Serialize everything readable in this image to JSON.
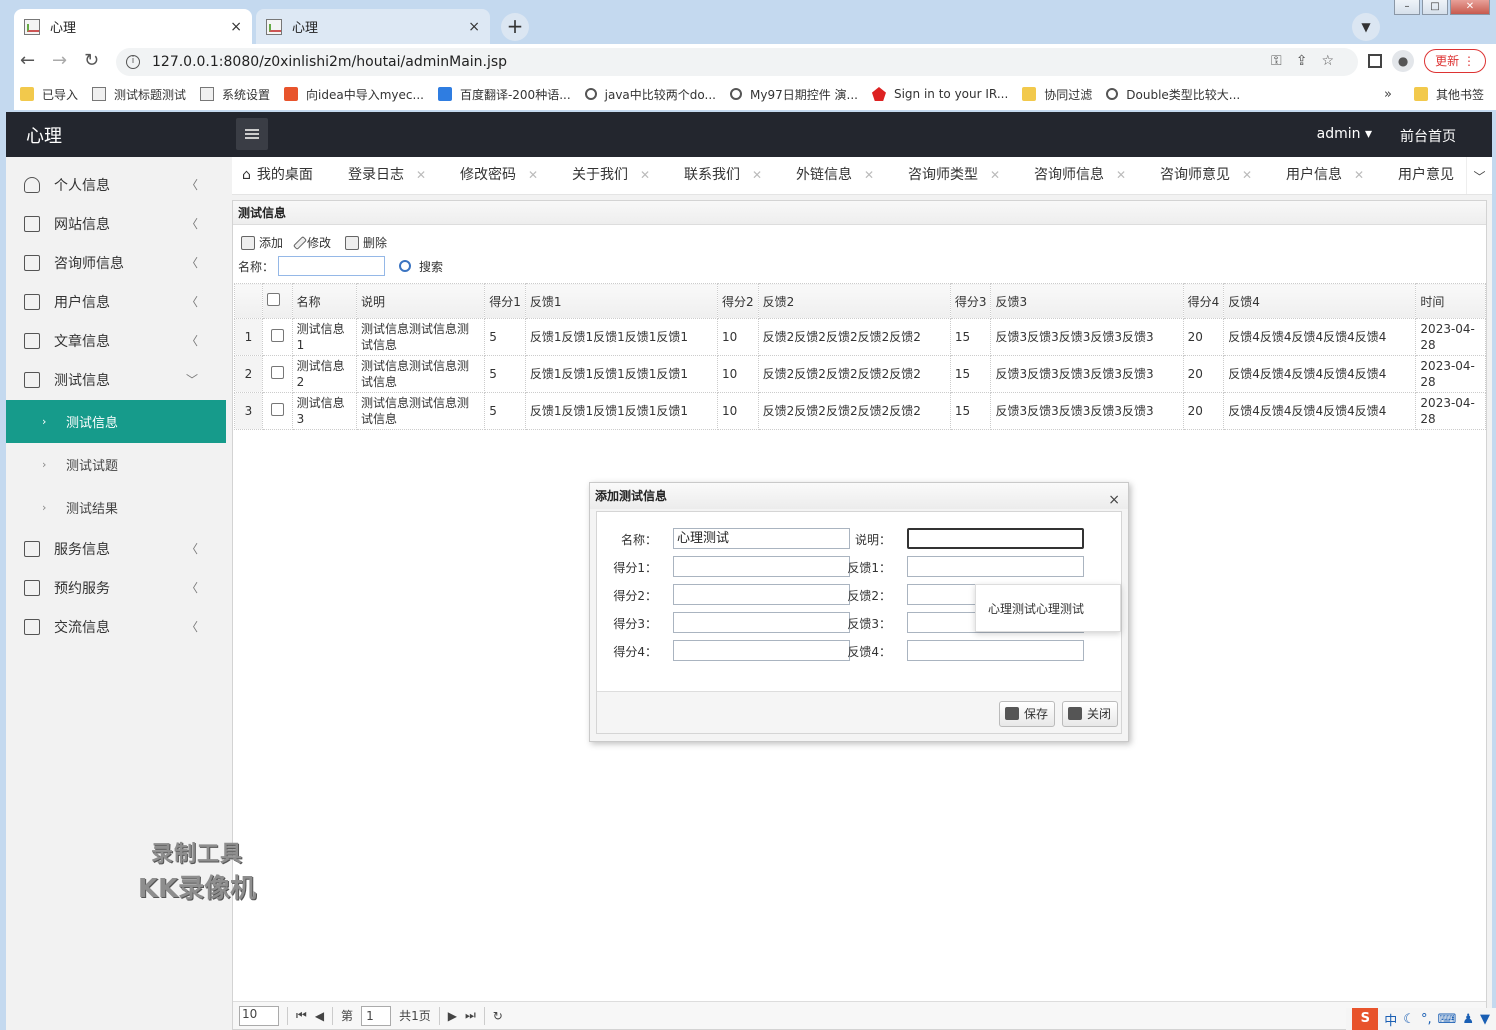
{
  "browser": {
    "tabs": [
      {
        "title": "心理"
      },
      {
        "title": "心理"
      }
    ],
    "tab_close": "×",
    "new_tab": "+",
    "url": "127.0.0.1:8080/z0xinlishi2m/houtai/adminMain.jsp",
    "update_label": "更新",
    "bookmarks": [
      {
        "label": "已导入",
        "icon": "folder"
      },
      {
        "label": "测试标题测试",
        "icon": "pic"
      },
      {
        "label": "系统设置",
        "icon": "pic"
      },
      {
        "label": "向idea中导入myec...",
        "icon": "red"
      },
      {
        "label": "百度翻译-200种语...",
        "icon": "blue"
      },
      {
        "label": "java中比较两个do...",
        "icon": "swirl"
      },
      {
        "label": "My97日期控件 演...",
        "icon": "swirl"
      },
      {
        "label": "Sign in to your IR...",
        "icon": "leaf"
      },
      {
        "label": "协同过滤",
        "icon": "folder"
      },
      {
        "label": "Double类型比较大...",
        "icon": "swirl"
      }
    ],
    "bookmarks_more": "»",
    "other_bookmarks": "其他书签"
  },
  "header": {
    "logo": "心理",
    "user": "admin ▾",
    "home_link": "前台首页"
  },
  "sidebar": {
    "items": [
      {
        "label": "个人信息"
      },
      {
        "label": "网站信息"
      },
      {
        "label": "咨询师信息"
      },
      {
        "label": "用户信息"
      },
      {
        "label": "文章信息"
      },
      {
        "label": "测试信息"
      },
      {
        "label": "服务信息"
      },
      {
        "label": "预约服务"
      },
      {
        "label": "交流信息"
      }
    ],
    "subitems": [
      {
        "label": "测试信息"
      },
      {
        "label": "测试试题"
      },
      {
        "label": "测试结果"
      }
    ]
  },
  "page_tabs": [
    {
      "label": "我的桌面"
    },
    {
      "label": "登录日志"
    },
    {
      "label": "修改密码"
    },
    {
      "label": "关于我们"
    },
    {
      "label": "联系我们"
    },
    {
      "label": "外链信息"
    },
    {
      "label": "咨询师类型"
    },
    {
      "label": "咨询师信息"
    },
    {
      "label": "咨询师意见"
    },
    {
      "label": "用户信息"
    },
    {
      "label": "用户意见"
    }
  ],
  "panel": {
    "title": "测试信息",
    "tools": {
      "add": "添加",
      "edit": "修改",
      "delete": "删除"
    },
    "search_label": "名称：",
    "search_value": "",
    "search_button": "搜索"
  },
  "grid": {
    "headers": [
      "名称",
      "说明",
      "得分1",
      "反馈1",
      "得分2",
      "反馈2",
      "得分3",
      "反馈3",
      "得分4",
      "反馈4",
      "时间"
    ],
    "rows": [
      {
        "n": "1",
        "cells": [
          "测试信息1",
          "测试信息测试信息测试信息",
          "5",
          "反馈1反馈1反馈1反馈1反馈1",
          "10",
          "反馈2反馈2反馈2反馈2反馈2",
          "15",
          "反馈3反馈3反馈3反馈3反馈3",
          "20",
          "反馈4反馈4反馈4反馈4反馈4",
          "2023-04-28"
        ]
      },
      {
        "n": "2",
        "cells": [
          "测试信息2",
          "测试信息测试信息测试信息",
          "5",
          "反馈1反馈1反馈1反馈1反馈1",
          "10",
          "反馈2反馈2反馈2反馈2反馈2",
          "15",
          "反馈3反馈3反馈3反馈3反馈3",
          "20",
          "反馈4反馈4反馈4反馈4反馈4",
          "2023-04-28"
        ]
      },
      {
        "n": "3",
        "cells": [
          "测试信息3",
          "测试信息测试信息测试信息",
          "5",
          "反馈1反馈1反馈1反馈1反馈1",
          "10",
          "反馈2反馈2反馈2反馈2反馈2",
          "15",
          "反馈3反馈3反馈3反馈3反馈3",
          "20",
          "反馈4反馈4反馈4反馈4反馈4",
          "2023-04-28"
        ]
      }
    ]
  },
  "pager": {
    "page_size": "10",
    "page_prefix": "第",
    "page_number": "1",
    "page_total": "共1页"
  },
  "dialog": {
    "title": "添加测试信息",
    "close": "×",
    "labels": {
      "name": "名称：",
      "desc": "说明：",
      "score1": "得分1：",
      "fb1": "反馈1：",
      "score2": "得分2：",
      "fb2": "反馈2：",
      "score3": "得分3：",
      "fb3": "反馈3：",
      "score4": "得分4：",
      "fb4": "反馈4："
    },
    "values": {
      "name": "心理测试",
      "desc": "",
      "score1": "",
      "fb1": "",
      "score2": "",
      "fb2": "",
      "score3": "",
      "fb3": "",
      "score4": "",
      "fb4": ""
    },
    "autocomplete_suggestion": "心理测试心理测试",
    "save": "保存",
    "close_button": "关闭"
  },
  "watermark": {
    "line1": "录制工具",
    "line2": "KK录像机"
  },
  "ime": {
    "mode": "中"
  }
}
